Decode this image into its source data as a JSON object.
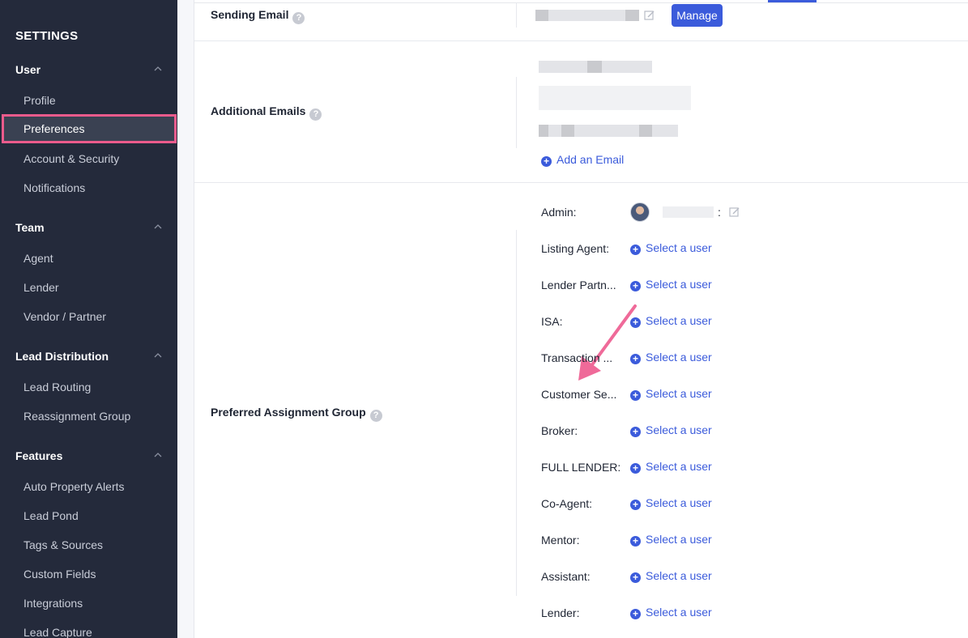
{
  "sidebar": {
    "heading": "SETTINGS",
    "sections": [
      {
        "title": "User",
        "items": [
          "Profile",
          "Preferences",
          "Account & Security",
          "Notifications"
        ]
      },
      {
        "title": "Team",
        "items": [
          "Agent",
          "Lender",
          "Vendor / Partner"
        ]
      },
      {
        "title": "Lead Distribution",
        "items": [
          "Lead Routing",
          "Reassignment Group"
        ]
      },
      {
        "title": "Features",
        "items": [
          "Auto Property Alerts",
          "Lead Pond",
          "Tags & Sources",
          "Custom Fields",
          "Integrations",
          "Lead Capture"
        ]
      }
    ],
    "active_item": "Preferences"
  },
  "main": {
    "sending_email": {
      "label": "Sending Email",
      "manage_label": "Manage"
    },
    "additional_emails": {
      "label": "Additional Emails",
      "add_label": "Add an Email"
    },
    "assignment": {
      "label": "Preferred Assignment Group",
      "admin_label": "Admin:",
      "admin_suffix": ":",
      "select_label": "Select a user",
      "roles": [
        "Listing Agent:",
        "Lender Partn...",
        "ISA:",
        "Transaction ...",
        "Customer Se...",
        "Broker:",
        "FULL LENDER:",
        "Co-Agent:",
        "Mentor:",
        "Assistant:",
        "Lender:"
      ]
    }
  },
  "colors": {
    "accent": "#3b5bdb",
    "sidebar_bg": "#242a3b",
    "highlight": "#ec5b8c"
  }
}
